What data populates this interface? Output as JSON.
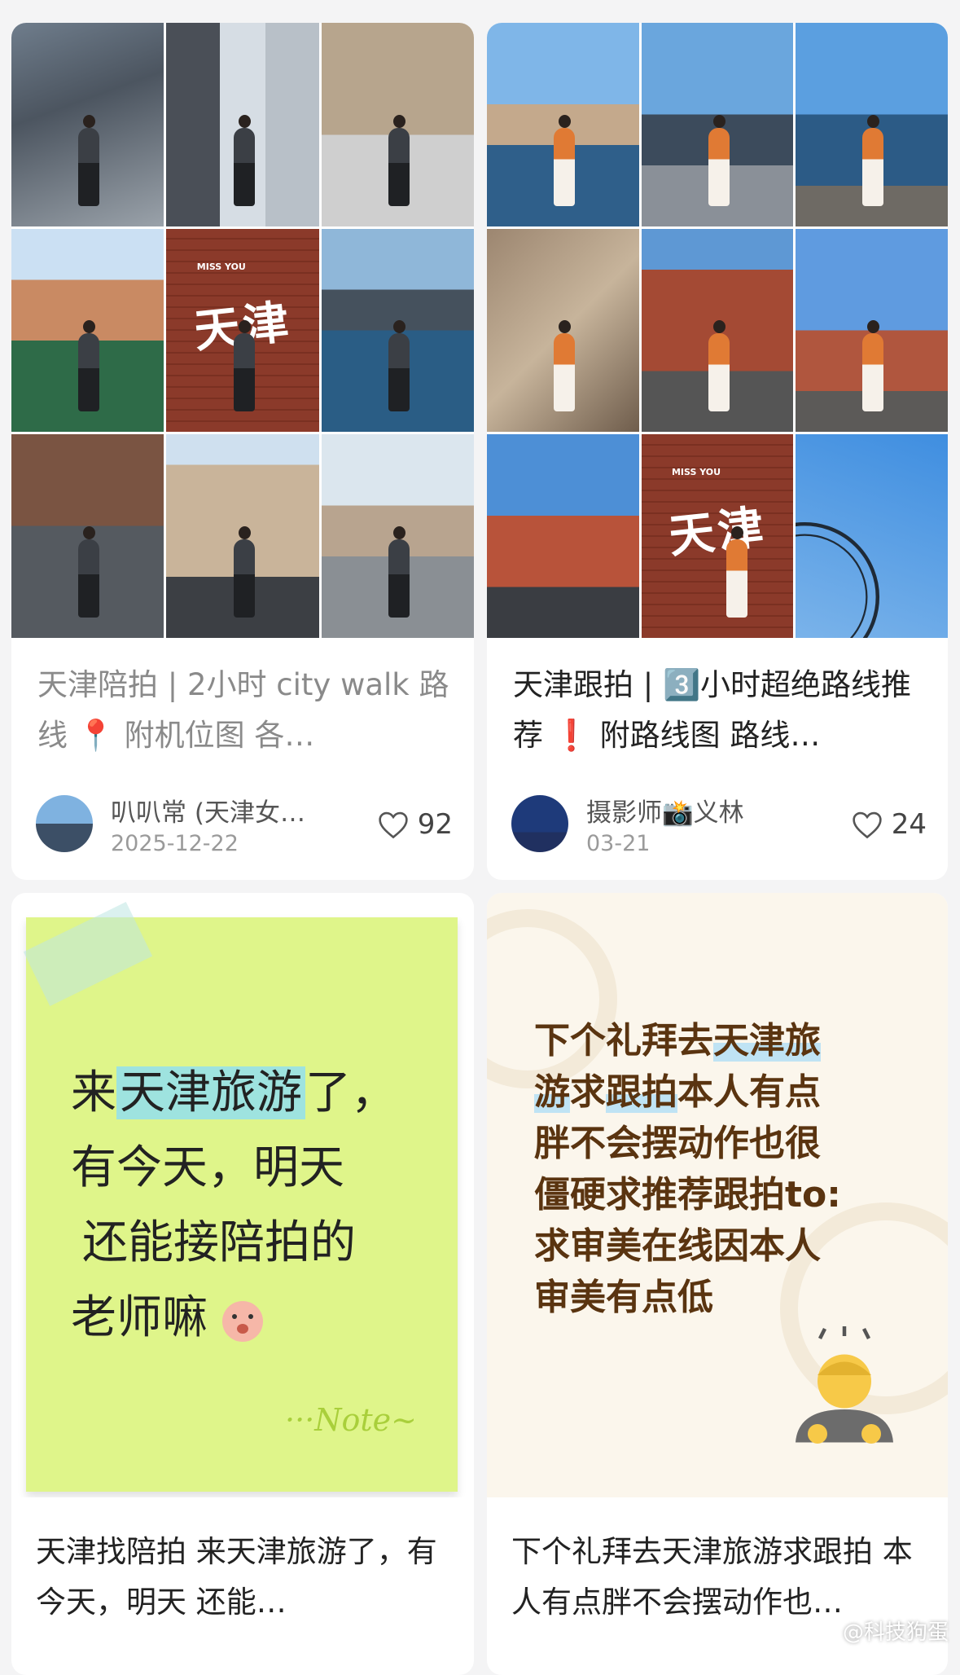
{
  "cards": [
    {
      "title": "天津陪拍 | 2小时 city walk 路线 📍 附机位图 各…",
      "author": "叭叭常 (天津女…",
      "date": "2025-12-22",
      "likes": "92",
      "wall_text": "天津",
      "wall_small": "MISS YOU"
    },
    {
      "title": "天津跟拍 | 3️⃣小时超绝路线推荐 ❗ 附路线图 路线…",
      "author": "摄影师📸义林",
      "date": "03-21",
      "likes": "24",
      "wall_text": "天津",
      "wall_small": "MISS YOU"
    },
    {
      "note_line1_pre": "来",
      "note_line1_hl": "天津旅游",
      "note_line1_post": "了，",
      "note_line2": "有今天，明天",
      "note_line3": "还能接陪拍的",
      "note_line4": "老师嘛",
      "note_sign": "···Note~",
      "title": "天津找陪拍 来天津旅游了，有今天，明天 还能…"
    },
    {
      "line1_pre": "下个礼拜去",
      "line1_hl": "天津旅",
      "line2_hl": "游",
      "line2_mid": "求",
      "line2_hl2": "跟拍",
      "line2_post": "本人有点",
      "line3": "胖不会摆动作也很",
      "line4": "僵硬求推荐跟拍to:",
      "line5": "求审美在线因本人",
      "line6": "审美有点低",
      "title": "下个礼拜去天津旅游求跟拍 本人有点胖不会摆动作也…"
    }
  ],
  "watermark": "@科技狗蛋",
  "colors": {
    "background": "#f4f4f5",
    "sticky_note": "#dff58a",
    "text_cover": "#fbf6ec",
    "text_brown": "#5a3410"
  }
}
